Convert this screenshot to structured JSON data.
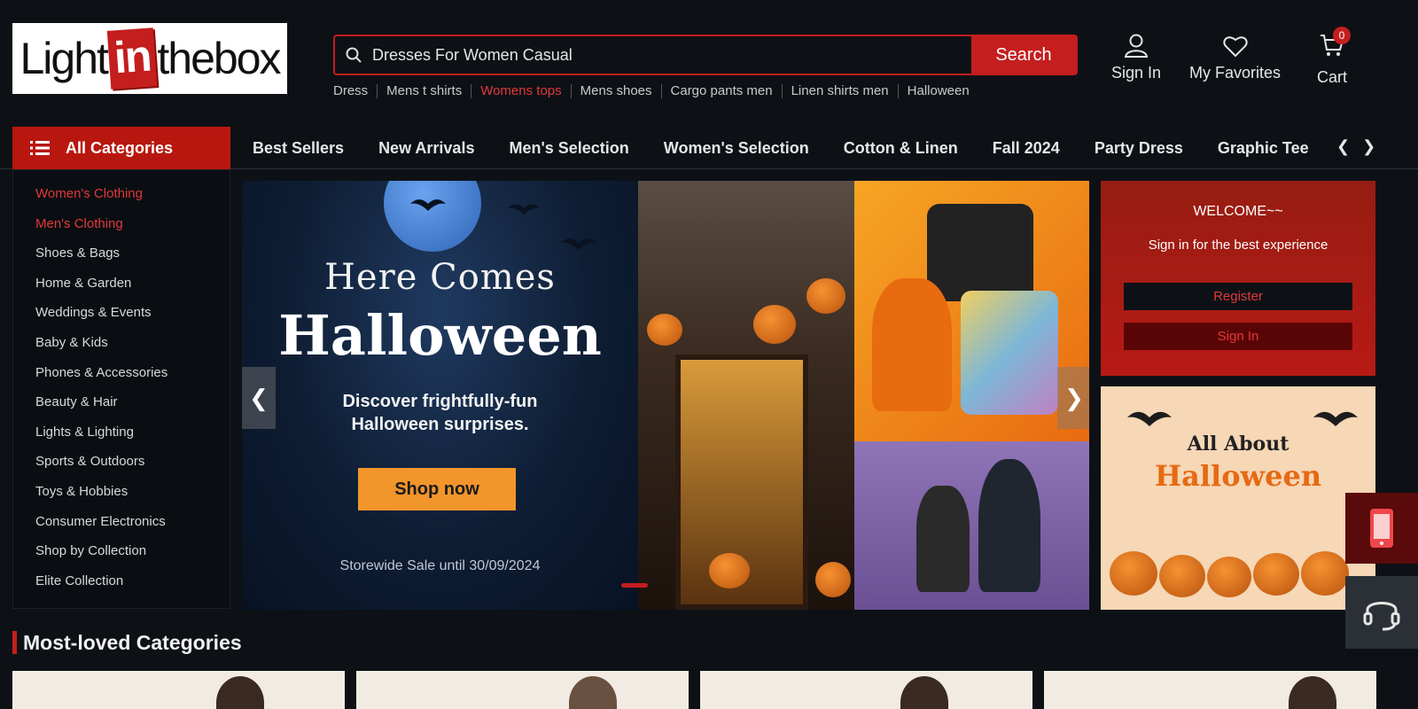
{
  "header": {
    "logo": {
      "left": "Light",
      "mid": "in",
      "right": "thebox"
    },
    "search": {
      "value": "Dresses For Women Casual",
      "placeholder": "",
      "button_label": "Search"
    },
    "hot_words": [
      "Dress",
      "Mens t shirts",
      "Womens tops",
      "Mens shoes",
      "Cargo pants men",
      "Linen shirts men",
      "Halloween"
    ],
    "hot_words_active_index": 2,
    "sign_in_label": "Sign In",
    "favorites_label": "My Favorites",
    "cart_label": "Cart",
    "cart_count": "0"
  },
  "nav": {
    "all_categories_label": "All Categories",
    "links": [
      "Best Sellers",
      "New Arrivals",
      "Men's Selection",
      "Women's Selection",
      "Cotton & Linen",
      "Fall 2024",
      "Party Dress",
      "Graphic Tee"
    ]
  },
  "sidebar": {
    "items": [
      {
        "label": "Women's Clothing",
        "active": true
      },
      {
        "label": "Men's Clothing",
        "active": true
      },
      {
        "label": "Shoes & Bags",
        "active": false
      },
      {
        "label": "Home & Garden",
        "active": false
      },
      {
        "label": "Weddings & Events",
        "active": false
      },
      {
        "label": "Baby & Kids",
        "active": false
      },
      {
        "label": "Phones & Accessories",
        "active": false
      },
      {
        "label": "Beauty & Hair",
        "active": false
      },
      {
        "label": "Lights & Lighting",
        "active": false
      },
      {
        "label": "Sports & Outdoors",
        "active": false
      },
      {
        "label": "Toys & Hobbies",
        "active": false
      },
      {
        "label": "Consumer Electronics",
        "active": false
      },
      {
        "label": "Shop by Collection",
        "active": false
      },
      {
        "label": "Elite Collection",
        "active": false
      }
    ]
  },
  "banner": {
    "title_line1": "Here Comes",
    "title_line2": "Halloween",
    "subtitle_line1": "Discover frightfully-fun",
    "subtitle_line2": "Halloween surprises.",
    "cta_label": "Shop now",
    "sale_text": "Storewide Sale until 30/09/2024"
  },
  "welcome": {
    "title": "WELCOME~~",
    "subtitle": "Sign in for the best experience",
    "register_label": "Register",
    "sign_in_label": "Sign In"
  },
  "promo": {
    "line1": "All About",
    "line2": "Halloween"
  },
  "most_loved": {
    "title": "Most-loved Categories"
  },
  "colors": {
    "accent": "#c41e1e",
    "active_text": "#e0393b",
    "background": "#0d1116"
  }
}
